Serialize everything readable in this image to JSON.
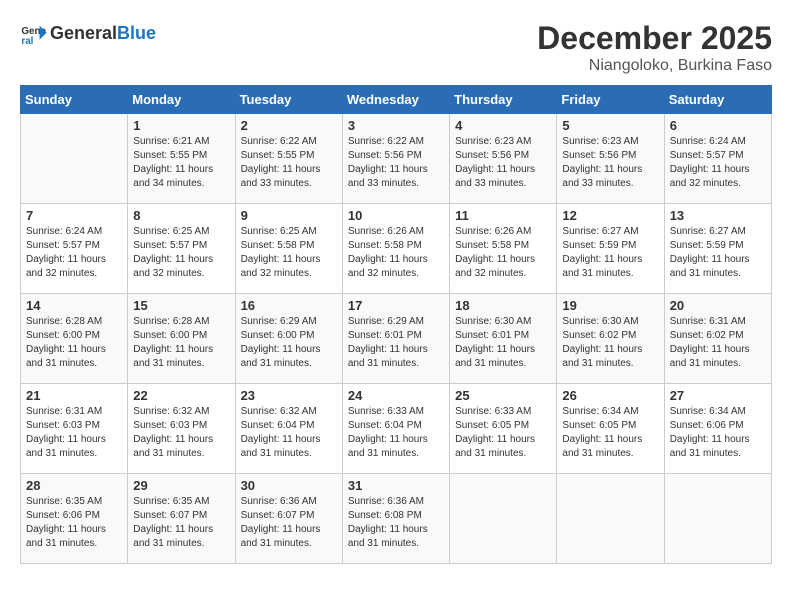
{
  "header": {
    "logo_line1": "General",
    "logo_line2": "Blue",
    "month": "December 2025",
    "location": "Niangoloko, Burkina Faso"
  },
  "days_of_week": [
    "Sunday",
    "Monday",
    "Tuesday",
    "Wednesday",
    "Thursday",
    "Friday",
    "Saturday"
  ],
  "weeks": [
    [
      {
        "day": "",
        "sunrise": "",
        "sunset": "",
        "daylight": ""
      },
      {
        "day": "1",
        "sunrise": "Sunrise: 6:21 AM",
        "sunset": "Sunset: 5:55 PM",
        "daylight": "Daylight: 11 hours and 34 minutes."
      },
      {
        "day": "2",
        "sunrise": "Sunrise: 6:22 AM",
        "sunset": "Sunset: 5:55 PM",
        "daylight": "Daylight: 11 hours and 33 minutes."
      },
      {
        "day": "3",
        "sunrise": "Sunrise: 6:22 AM",
        "sunset": "Sunset: 5:56 PM",
        "daylight": "Daylight: 11 hours and 33 minutes."
      },
      {
        "day": "4",
        "sunrise": "Sunrise: 6:23 AM",
        "sunset": "Sunset: 5:56 PM",
        "daylight": "Daylight: 11 hours and 33 minutes."
      },
      {
        "day": "5",
        "sunrise": "Sunrise: 6:23 AM",
        "sunset": "Sunset: 5:56 PM",
        "daylight": "Daylight: 11 hours and 33 minutes."
      },
      {
        "day": "6",
        "sunrise": "Sunrise: 6:24 AM",
        "sunset": "Sunset: 5:57 PM",
        "daylight": "Daylight: 11 hours and 32 minutes."
      }
    ],
    [
      {
        "day": "7",
        "sunrise": "Sunrise: 6:24 AM",
        "sunset": "Sunset: 5:57 PM",
        "daylight": "Daylight: 11 hours and 32 minutes."
      },
      {
        "day": "8",
        "sunrise": "Sunrise: 6:25 AM",
        "sunset": "Sunset: 5:57 PM",
        "daylight": "Daylight: 11 hours and 32 minutes."
      },
      {
        "day": "9",
        "sunrise": "Sunrise: 6:25 AM",
        "sunset": "Sunset: 5:58 PM",
        "daylight": "Daylight: 11 hours and 32 minutes."
      },
      {
        "day": "10",
        "sunrise": "Sunrise: 6:26 AM",
        "sunset": "Sunset: 5:58 PM",
        "daylight": "Daylight: 11 hours and 32 minutes."
      },
      {
        "day": "11",
        "sunrise": "Sunrise: 6:26 AM",
        "sunset": "Sunset: 5:58 PM",
        "daylight": "Daylight: 11 hours and 32 minutes."
      },
      {
        "day": "12",
        "sunrise": "Sunrise: 6:27 AM",
        "sunset": "Sunset: 5:59 PM",
        "daylight": "Daylight: 11 hours and 31 minutes."
      },
      {
        "day": "13",
        "sunrise": "Sunrise: 6:27 AM",
        "sunset": "Sunset: 5:59 PM",
        "daylight": "Daylight: 11 hours and 31 minutes."
      }
    ],
    [
      {
        "day": "14",
        "sunrise": "Sunrise: 6:28 AM",
        "sunset": "Sunset: 6:00 PM",
        "daylight": "Daylight: 11 hours and 31 minutes."
      },
      {
        "day": "15",
        "sunrise": "Sunrise: 6:28 AM",
        "sunset": "Sunset: 6:00 PM",
        "daylight": "Daylight: 11 hours and 31 minutes."
      },
      {
        "day": "16",
        "sunrise": "Sunrise: 6:29 AM",
        "sunset": "Sunset: 6:00 PM",
        "daylight": "Daylight: 11 hours and 31 minutes."
      },
      {
        "day": "17",
        "sunrise": "Sunrise: 6:29 AM",
        "sunset": "Sunset: 6:01 PM",
        "daylight": "Daylight: 11 hours and 31 minutes."
      },
      {
        "day": "18",
        "sunrise": "Sunrise: 6:30 AM",
        "sunset": "Sunset: 6:01 PM",
        "daylight": "Daylight: 11 hours and 31 minutes."
      },
      {
        "day": "19",
        "sunrise": "Sunrise: 6:30 AM",
        "sunset": "Sunset: 6:02 PM",
        "daylight": "Daylight: 11 hours and 31 minutes."
      },
      {
        "day": "20",
        "sunrise": "Sunrise: 6:31 AM",
        "sunset": "Sunset: 6:02 PM",
        "daylight": "Daylight: 11 hours and 31 minutes."
      }
    ],
    [
      {
        "day": "21",
        "sunrise": "Sunrise: 6:31 AM",
        "sunset": "Sunset: 6:03 PM",
        "daylight": "Daylight: 11 hours and 31 minutes."
      },
      {
        "day": "22",
        "sunrise": "Sunrise: 6:32 AM",
        "sunset": "Sunset: 6:03 PM",
        "daylight": "Daylight: 11 hours and 31 minutes."
      },
      {
        "day": "23",
        "sunrise": "Sunrise: 6:32 AM",
        "sunset": "Sunset: 6:04 PM",
        "daylight": "Daylight: 11 hours and 31 minutes."
      },
      {
        "day": "24",
        "sunrise": "Sunrise: 6:33 AM",
        "sunset": "Sunset: 6:04 PM",
        "daylight": "Daylight: 11 hours and 31 minutes."
      },
      {
        "day": "25",
        "sunrise": "Sunrise: 6:33 AM",
        "sunset": "Sunset: 6:05 PM",
        "daylight": "Daylight: 11 hours and 31 minutes."
      },
      {
        "day": "26",
        "sunrise": "Sunrise: 6:34 AM",
        "sunset": "Sunset: 6:05 PM",
        "daylight": "Daylight: 11 hours and 31 minutes."
      },
      {
        "day": "27",
        "sunrise": "Sunrise: 6:34 AM",
        "sunset": "Sunset: 6:06 PM",
        "daylight": "Daylight: 11 hours and 31 minutes."
      }
    ],
    [
      {
        "day": "28",
        "sunrise": "Sunrise: 6:35 AM",
        "sunset": "Sunset: 6:06 PM",
        "daylight": "Daylight: 11 hours and 31 minutes."
      },
      {
        "day": "29",
        "sunrise": "Sunrise: 6:35 AM",
        "sunset": "Sunset: 6:07 PM",
        "daylight": "Daylight: 11 hours and 31 minutes."
      },
      {
        "day": "30",
        "sunrise": "Sunrise: 6:36 AM",
        "sunset": "Sunset: 6:07 PM",
        "daylight": "Daylight: 11 hours and 31 minutes."
      },
      {
        "day": "31",
        "sunrise": "Sunrise: 6:36 AM",
        "sunset": "Sunset: 6:08 PM",
        "daylight": "Daylight: 11 hours and 31 minutes."
      },
      {
        "day": "",
        "sunrise": "",
        "sunset": "",
        "daylight": ""
      },
      {
        "day": "",
        "sunrise": "",
        "sunset": "",
        "daylight": ""
      },
      {
        "day": "",
        "sunrise": "",
        "sunset": "",
        "daylight": ""
      }
    ]
  ]
}
